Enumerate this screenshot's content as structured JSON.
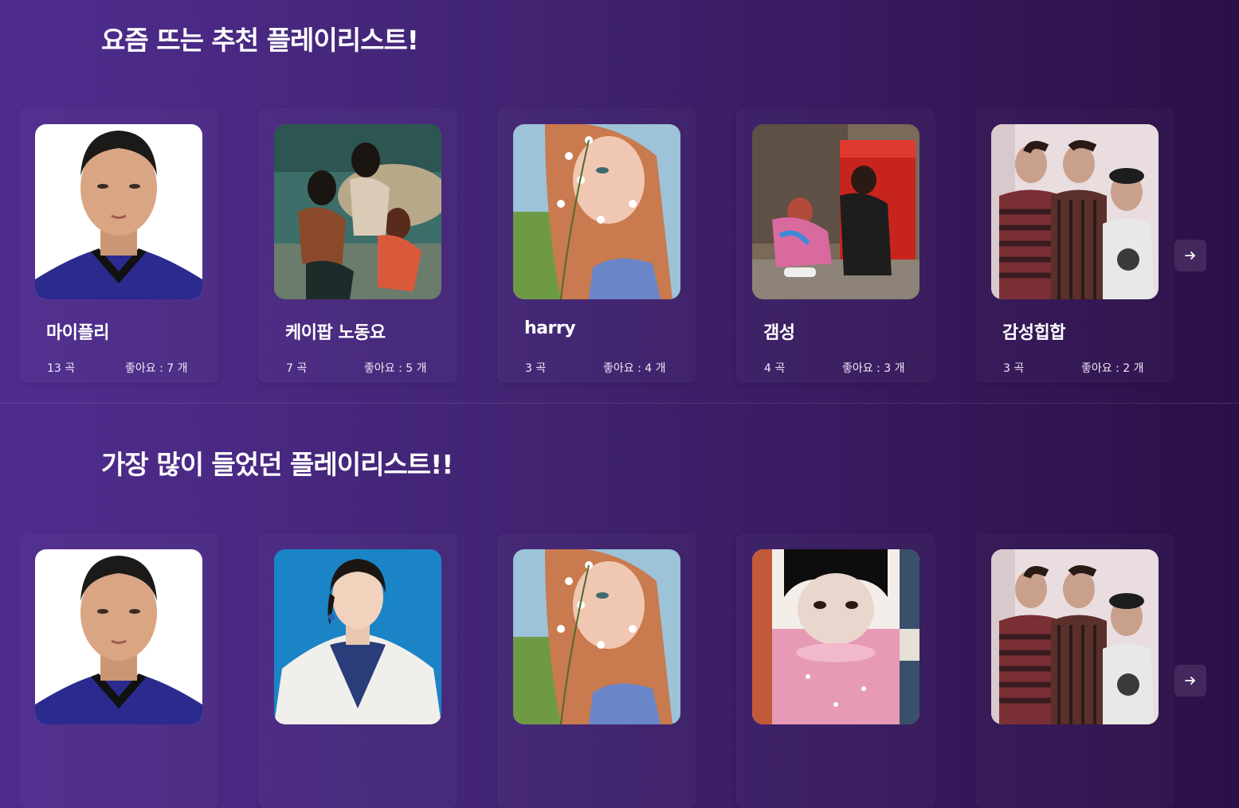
{
  "sections": [
    {
      "title": "요즘 뜨는 추천 플레이리스트!",
      "cards": [
        {
          "title": "마이플리",
          "count": "13 곡",
          "likes": "좋아요 : 7 개",
          "cover": "soccer-player-portrait"
        },
        {
          "title": "케이팝 노동요",
          "count": "7 곡",
          "likes": "좋아요 : 5 개",
          "cover": "girl-group-photo"
        },
        {
          "title": "harry",
          "count": "3 곡",
          "likes": "좋아요 : 4 개",
          "cover": "woman-with-flowers"
        },
        {
          "title": "갬성",
          "count": "4 곡",
          "likes": "좋아요 : 3 개",
          "cover": "two-people-by-red-bin"
        },
        {
          "title": "감성힙합",
          "count": "3 곡",
          "likes": "좋아요 : 2 개",
          "cover": "three-men-photo"
        }
      ],
      "next_icon": "arrow-right-icon"
    },
    {
      "title": "가장 많이 들었던 플레이리스트!!",
      "cards": [
        {
          "title": "",
          "cover": "soccer-player-portrait"
        },
        {
          "title": "",
          "cover": "woman-in-white-blazer"
        },
        {
          "title": "",
          "cover": "woman-with-flowers"
        },
        {
          "title": "",
          "cover": "woman-in-pink-water"
        },
        {
          "title": "",
          "cover": "three-men-photo"
        }
      ],
      "next_icon": "arrow-right-icon"
    }
  ],
  "colors": {
    "background_start": "#4f2d8f",
    "background_end": "#2c0f47",
    "text": "#ffffff"
  }
}
